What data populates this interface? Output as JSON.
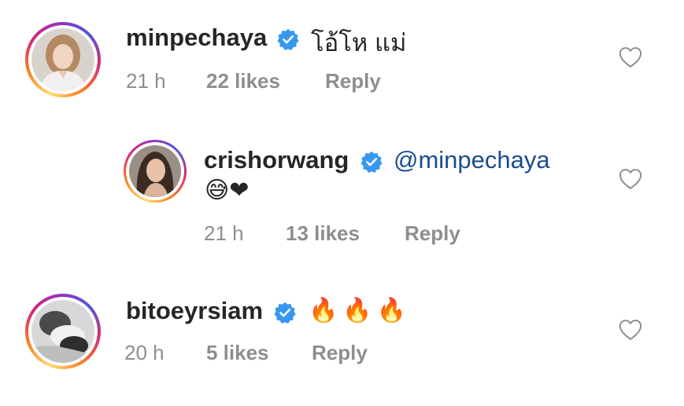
{
  "comments": [
    {
      "username": "minpechaya",
      "text": "โอ้โห แม่",
      "time": "21 h",
      "likes": "22 likes",
      "reply_label": "Reply",
      "avatar": "woman-light-hair-photo"
    },
    {
      "username": "crishorwang",
      "mention": "@minpechaya",
      "emoji": "😅❤",
      "time": "21 h",
      "likes": "13 likes",
      "reply_label": "Reply",
      "avatar": "woman-dark-hair-photo"
    },
    {
      "username": "bitoeyrsiam",
      "emoji": "🔥🔥🔥",
      "time": "20 h",
      "likes": "5 likes",
      "reply_label": "Reply",
      "avatar": "black-and-white-couple-photo"
    }
  ],
  "colors": {
    "verified": "#3897f0",
    "mention": "#1b4c8f",
    "meta": "#8e8e8e"
  },
  "icons": [
    "verified-badge-icon",
    "heart-outline-icon"
  ]
}
